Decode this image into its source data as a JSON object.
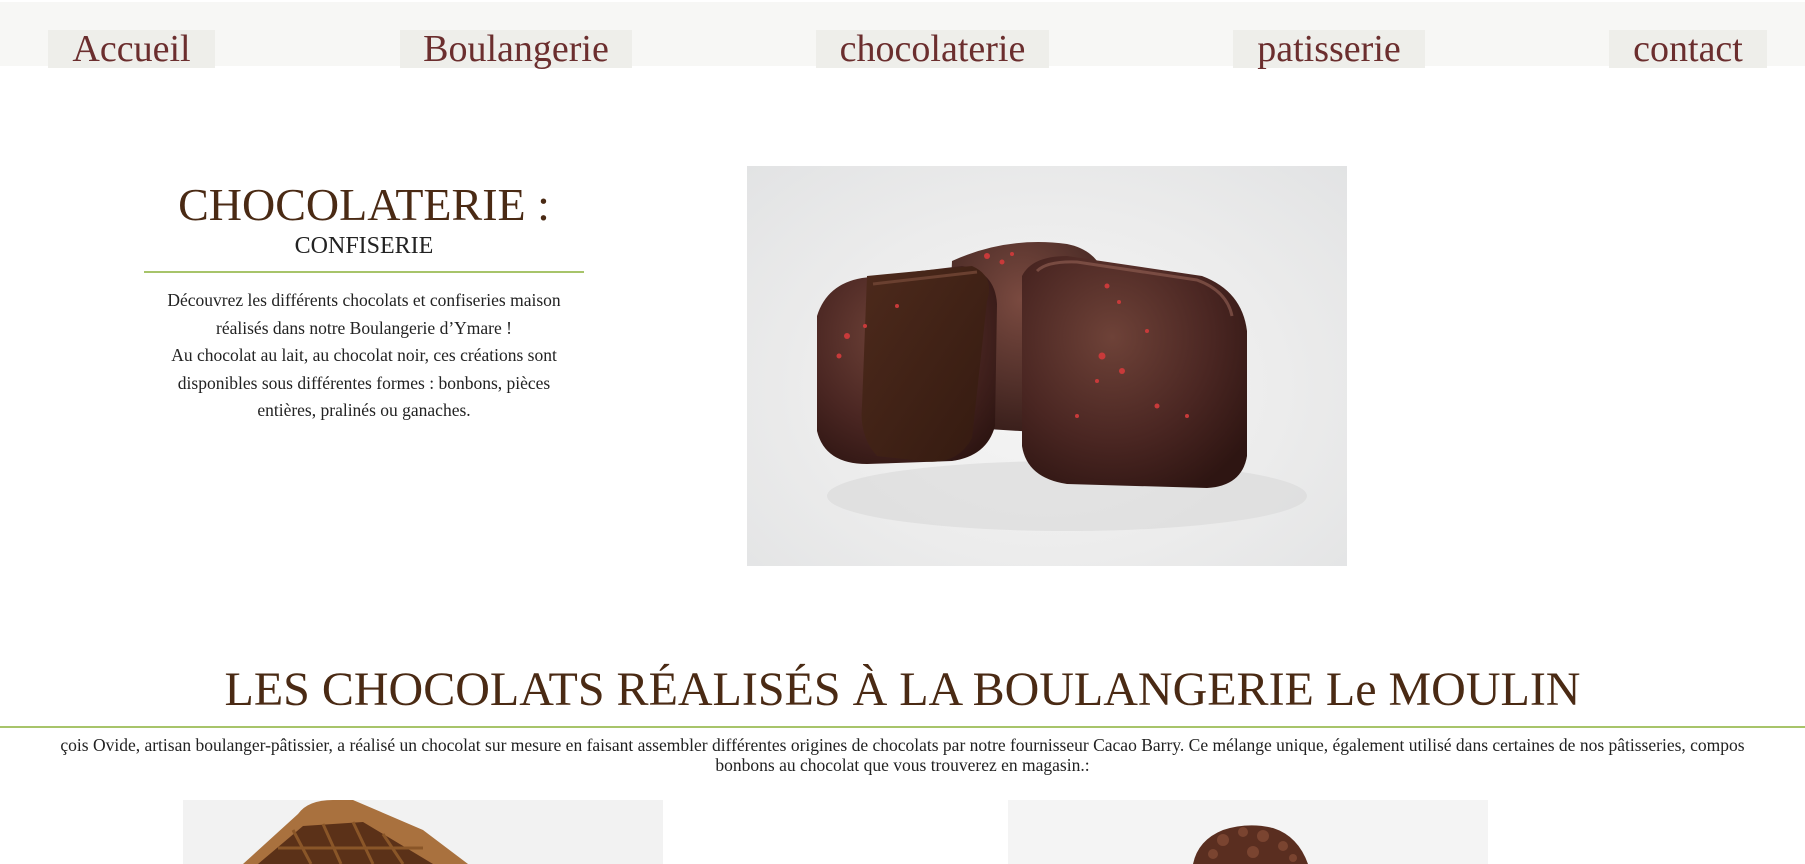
{
  "nav": {
    "items": [
      {
        "label": "Accueil"
      },
      {
        "label": "Boulangerie"
      },
      {
        "label": "chocolaterie"
      },
      {
        "label": "patisserie"
      },
      {
        "label": "contact"
      }
    ]
  },
  "intro": {
    "title": "CHOCOLATERIE :",
    "subtitle": "CONFISERIE",
    "line1": "Découvrez les différents chocolats et confiseries maison",
    "line2": "réalisés dans notre Boulangerie d’Ymare !",
    "line3": "Au chocolat au lait, au chocolat noir, ces créations sont",
    "line4": "disponibles sous différentes formes : bonbons, pièces",
    "line5": "entières, pralinés ou ganaches."
  },
  "section": {
    "title": "LES CHOCOLATS RÉALISÉS À LA BOULANGERIE Le MOULIN",
    "line1": "çois Ovide, artisan boulanger-pâtissier, a réalisé un chocolat sur mesure en faisant assembler différentes origines de chocolats par notre fournisseur Cacao Barry. Ce mélange unique, également utilisé dans certaines de nos pâtisseries, compos",
    "line2": "bonbons au chocolat que vous trouverez en magasin.:"
  },
  "colors": {
    "nav_text": "#6b2e2e",
    "heading": "#4a2a14",
    "accent_line": "#a7c46a",
    "nav_bg": "#f7f7f5"
  }
}
